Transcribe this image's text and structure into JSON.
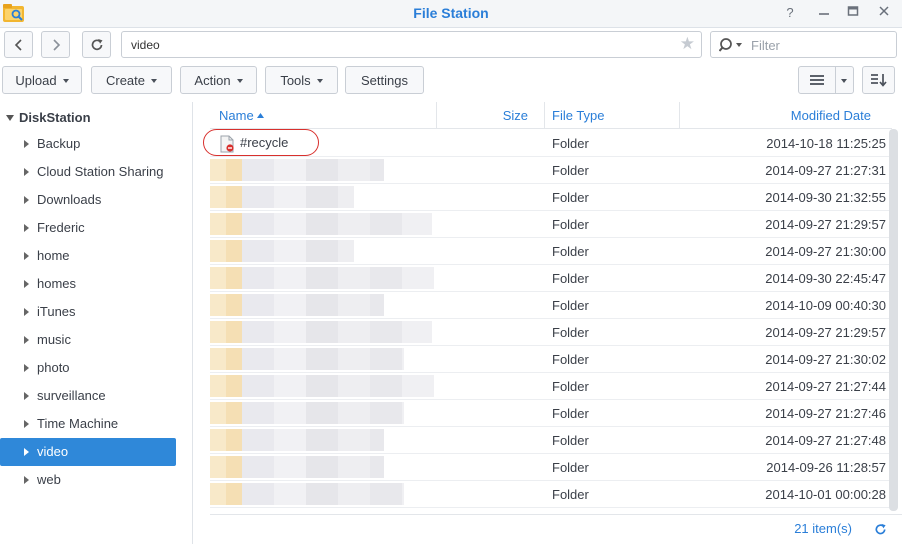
{
  "window": {
    "title": "File Station",
    "controls": [
      "help-icon",
      "minimize-icon",
      "maximize-icon",
      "close-icon"
    ]
  },
  "nav": {
    "path": "video",
    "search_placeholder": "Filter"
  },
  "toolbar": {
    "upload": "Upload",
    "create": "Create",
    "action": "Action",
    "tools": "Tools",
    "settings": "Settings"
  },
  "sidebar": {
    "root": "DiskStation",
    "items": [
      {
        "label": "Backup"
      },
      {
        "label": "Cloud Station Sharing"
      },
      {
        "label": "Downloads"
      },
      {
        "label": "Frederic"
      },
      {
        "label": "home"
      },
      {
        "label": "homes"
      },
      {
        "label": "iTunes"
      },
      {
        "label": "music"
      },
      {
        "label": "photo"
      },
      {
        "label": "surveillance"
      },
      {
        "label": "Time Machine"
      },
      {
        "label": "video"
      },
      {
        "label": "web"
      }
    ],
    "selected": "video"
  },
  "list": {
    "columns": {
      "name": "Name",
      "size": "Size",
      "type": "File Type",
      "modified": "Modified Date"
    },
    "rows": [
      {
        "name": "#recycle",
        "type": "Folder",
        "date": "2014-10-18 11:25:25"
      },
      {
        "name": "",
        "type": "Folder",
        "date": "2014-09-27 21:27:31"
      },
      {
        "name": "",
        "type": "Folder",
        "date": "2014-09-30 21:32:55"
      },
      {
        "name": "",
        "type": "Folder",
        "date": "2014-09-27 21:29:57"
      },
      {
        "name": "",
        "type": "Folder",
        "date": "2014-09-27 21:30:00"
      },
      {
        "name": "",
        "type": "Folder",
        "date": "2014-09-30 22:45:47"
      },
      {
        "name": "",
        "type": "Folder",
        "date": "2014-10-09 00:40:30"
      },
      {
        "name": "",
        "type": "Folder",
        "date": "2014-09-27 21:29:57"
      },
      {
        "name": "",
        "type": "Folder",
        "date": "2014-09-27 21:30:02"
      },
      {
        "name": "",
        "type": "Folder",
        "date": "2014-09-27 21:27:44"
      },
      {
        "name": "",
        "type": "Folder",
        "date": "2014-09-27 21:27:46"
      },
      {
        "name": "",
        "type": "Folder",
        "date": "2014-09-27 21:27:48"
      },
      {
        "name": "",
        "type": "Folder",
        "date": "2014-09-26 11:28:57"
      },
      {
        "name": "",
        "type": "Folder",
        "date": "2014-10-01 00:00:28"
      }
    ]
  },
  "status": {
    "count": "21 item(s)"
  },
  "colors": {
    "accent": "#2a7ed8",
    "selected_bg": "#2f88d9",
    "annotation": "#d8302d"
  }
}
